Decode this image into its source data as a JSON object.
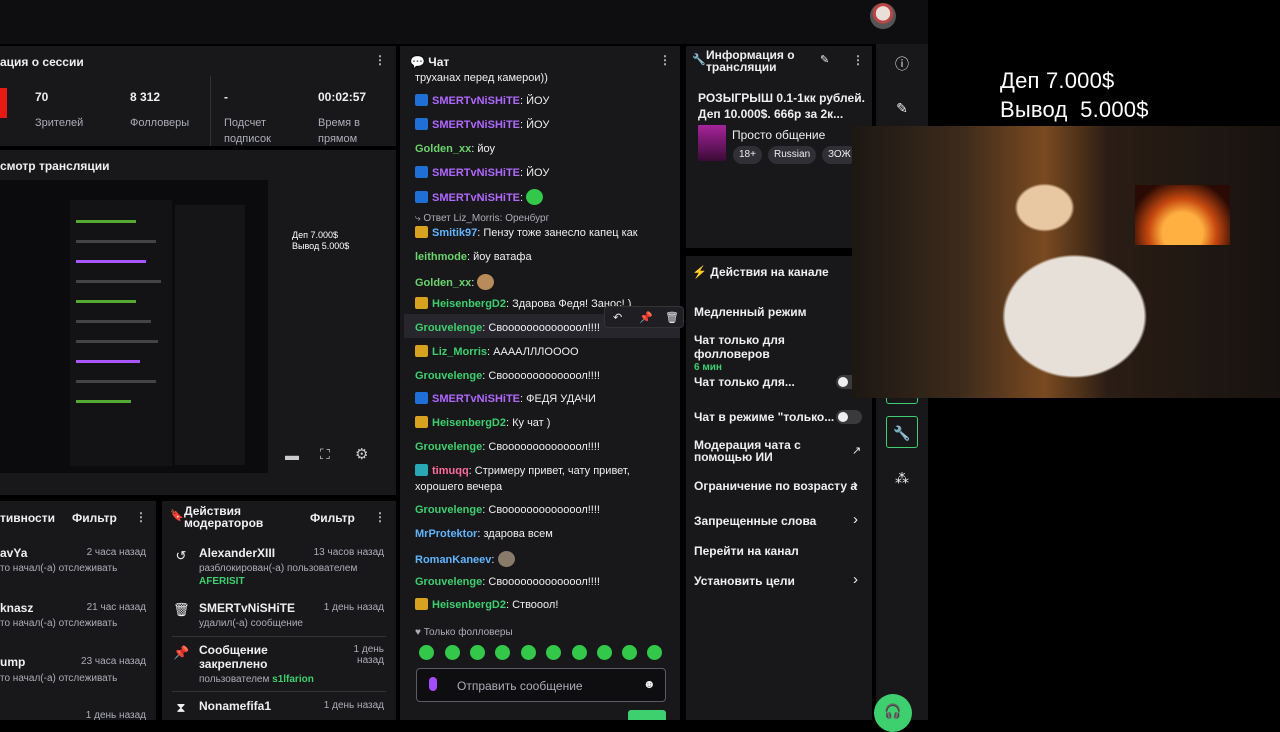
{
  "overlay": {
    "line1": "Деп 7.000$",
    "line2": "Вывод  5.000$"
  },
  "session": {
    "title": "ация о сессии",
    "stats": [
      {
        "value": "70",
        "label": "Зрителей"
      },
      {
        "value": "8 312",
        "label": "Фолловеры"
      },
      {
        "value": "-",
        "label": "Подсчет подписок"
      },
      {
        "value": "00:02:57",
        "label": "Время в прямом"
      }
    ]
  },
  "preview": {
    "title": "смотр трансляции",
    "mini_overlay1": "Деп 7.000$",
    "mini_overlay2": "Вывод  5.000$"
  },
  "chat": {
    "title": "Чат",
    "first_line": "труханах перед камерои))",
    "reply_note": "Ответ Liz_Morris: Оренбург",
    "messages": [
      {
        "user": "SMERTvNiSHiTE",
        "text": "ЙОУ",
        "color": "purple",
        "badge": "blue"
      },
      {
        "user": "SMERTvNiSHiTE",
        "text": "ЙОУ",
        "color": "purple",
        "badge": "blue"
      },
      {
        "user": "Golden_xx",
        "text": "йоу",
        "color": "olive",
        "badge": ""
      },
      {
        "user": "SMERTvNiSHiTE",
        "text": "ЙОУ",
        "color": "purple",
        "badge": "blue"
      },
      {
        "user": "SMERTvNiSHiTE",
        "text": "",
        "color": "purple",
        "badge": "blue"
      },
      {
        "user": "Smitik97",
        "text": "Пензу тоже занесло капец как",
        "color": "cyan",
        "badge": "gold"
      },
      {
        "user": "leithmode",
        "text": "йоу ватафа",
        "color": "olive",
        "badge": ""
      },
      {
        "user": "Golden_xx",
        "text": "",
        "color": "olive",
        "badge": ""
      },
      {
        "user": "HeisenbergD2",
        "text": "Здарова Федя! Занос! )",
        "color": "green",
        "badge": "gold"
      },
      {
        "user": "Grouvelenge",
        "text": "Свооооооооооооол!!!!",
        "color": "green",
        "badge": ""
      },
      {
        "user": "Liz_Morris",
        "text": "ААААЛЛЛОООО",
        "color": "green",
        "badge": "gold"
      },
      {
        "user": "Grouvelenge",
        "text": "Свооооооооооооол!!!!",
        "color": "green",
        "badge": ""
      },
      {
        "user": "SMERTvNiSHiTE",
        "text": "ФЕДЯ УДАЧИ",
        "color": "purple",
        "badge": "blue"
      },
      {
        "user": "HeisenbergD2",
        "text": "Ку чат )",
        "color": "green",
        "badge": "gold"
      },
      {
        "user": "Grouvelenge",
        "text": "Свооооооооооооол!!!!",
        "color": "green",
        "badge": ""
      },
      {
        "user": "timuqq",
        "text": "Стримеру привет, чату привет,",
        "color": "pink",
        "badge": "teal"
      },
      {
        "user": "",
        "text": "хорошего вечера",
        "color": "",
        "badge": ""
      },
      {
        "user": "Grouvelenge",
        "text": "Свооооооооооооол!!!!",
        "color": "green",
        "badge": ""
      },
      {
        "user": "MrProtektor",
        "text": "здарова всем",
        "color": "cyan",
        "badge": ""
      },
      {
        "user": "RomanKaneev",
        "text": "",
        "color": "cyan",
        "badge": ""
      },
      {
        "user": "Grouvelenge",
        "text": "Свооооооооооооол!!!!",
        "color": "green",
        "badge": ""
      },
      {
        "user": "HeisenbergD2",
        "text": "Ствооол!",
        "color": "green",
        "badge": "gold"
      }
    ],
    "followers_only": "Только фолловеры",
    "input_placeholder": "Отправить сообщение"
  },
  "stream_info": {
    "title": "Информация о трансляции",
    "stream_title": "РОЗЫГРЫШ 0.1-1кк рублей. Деп 10.000$. 666р за 2к...",
    "category": "Просто общение",
    "tags": [
      "18+",
      "Russian",
      "ЗОЖ"
    ]
  },
  "channel_actions": {
    "title": "Действия на канале",
    "items": [
      {
        "label": "Медленный режим"
      },
      {
        "label": "Чат только для фолловеров",
        "sub": "6 мин"
      },
      {
        "label": "Чат только для..."
      },
      {
        "label": "Чат в режиме \"только..."
      },
      {
        "label": "Модерация чата с помощью ИИ"
      },
      {
        "label": "Ограничение по возрасту а"
      },
      {
        "label": "Запрещенные слова"
      },
      {
        "label": "Перейти на канал"
      },
      {
        "label": "Установить цели"
      }
    ]
  },
  "activity": {
    "title": "тивности",
    "filter": "Фильтр",
    "items": [
      {
        "name": "avYa",
        "time": "2 часа назад",
        "desc": "то начал(-а) отслеживать"
      },
      {
        "name": "knasz",
        "time": "21 час назад",
        "desc": "то начал(-а) отслеживать"
      },
      {
        "name": "ump",
        "time": "23 часа назад",
        "desc": "то начал(-а) отслеживать"
      },
      {
        "name": "",
        "time": "1 день назад",
        "desc": ""
      }
    ]
  },
  "mod_actions": {
    "title": "Действия модераторов",
    "filter": "Фильтр",
    "items": [
      {
        "name": "AlexanderXIII",
        "time": "13 часов назад",
        "desc": "разблокирован(-а) пользователем",
        "extra": "AFERISIT"
      },
      {
        "name": "SMERTvNiSHiTE",
        "time": "1 день назад",
        "desc": "удалил(-а) сообщение",
        "extra": ""
      },
      {
        "name": "Сообщение закреплено",
        "time": "1 день назад",
        "desc": "пользователем",
        "extra": "s1lfarion"
      },
      {
        "name": "Nonamefifa1",
        "time": "1 день назад",
        "desc": "",
        "extra": ""
      }
    ]
  },
  "colors": {
    "bg": "#0e0e10",
    "panel": "#18181b",
    "green": "#3ecf6e",
    "purple": "#b068ff"
  }
}
